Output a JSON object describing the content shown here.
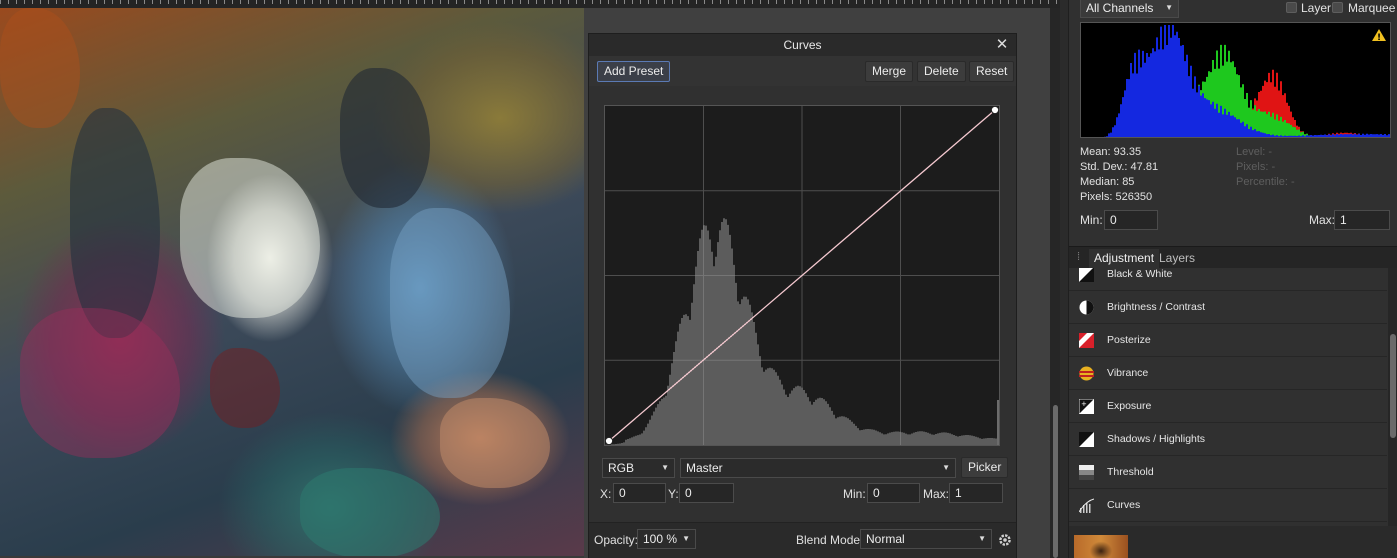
{
  "curves": {
    "title": "Curves",
    "close_glyph": "✕",
    "toolbar": {
      "add_preset": "Add Preset",
      "merge": "Merge",
      "delete": "Delete",
      "reset": "Reset"
    },
    "channel_select": "RGB",
    "mode_select": "Master",
    "picker": "Picker",
    "x_label": "X:",
    "x_value": "0",
    "y_label": "Y:",
    "y_value": "0",
    "min_label": "Min:",
    "min_value": "0",
    "max_label": "Max:",
    "max_value": "1",
    "opacity_label": "Opacity:",
    "opacity_value": "100 %",
    "blend_label": "Blend Mode:",
    "blend_value": "Normal",
    "curve_points": [
      [
        0,
        0
      ],
      [
        1,
        1
      ]
    ],
    "curve_color": "#f5c9d0"
  },
  "histogram_panel": {
    "channels": "All Channels",
    "layer_label": "Layer",
    "marquee_label": "Marquee",
    "warning_glyph": "!",
    "stats_left": [
      "Mean: 93.35",
      "Std. Dev.: 47.81",
      "Median: 85",
      "Pixels: 526350"
    ],
    "stats_right": [
      "Level: -",
      "Pixels: -",
      "Percentile: -"
    ],
    "min_label": "Min:",
    "min_value": "0",
    "max_label": "Max:",
    "max_value": "1",
    "colors": {
      "blue": "#1428e0",
      "green": "#1ec81e",
      "red": "#e01414"
    }
  },
  "adjustment_panel": {
    "tabs": [
      "Adjustment",
      "Layers"
    ],
    "items": [
      {
        "label": "Black & White",
        "icon": "black-white-icon"
      },
      {
        "label": "Brightness / Contrast",
        "icon": "brightness-contrast-icon"
      },
      {
        "label": "Posterize",
        "icon": "posterize-icon"
      },
      {
        "label": "Vibrance",
        "icon": "vibrance-icon"
      },
      {
        "label": "Exposure",
        "icon": "exposure-icon"
      },
      {
        "label": "Shadows / Highlights",
        "icon": "shadows-highlights-icon"
      },
      {
        "label": "Threshold",
        "icon": "threshold-icon"
      },
      {
        "label": "Curves",
        "icon": "curves-icon"
      }
    ]
  }
}
